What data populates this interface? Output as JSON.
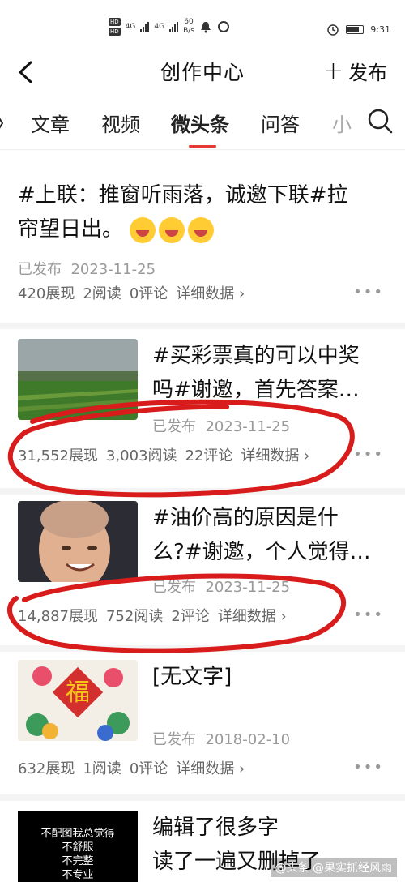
{
  "status": {
    "network_left": "4G",
    "network_right": "4G",
    "speed_value": "60",
    "speed_unit": "B/s",
    "time": "9:31"
  },
  "nav": {
    "title": "创作中心",
    "publish_label": "发布"
  },
  "tabs": [
    {
      "label": "文章"
    },
    {
      "label": "视频"
    },
    {
      "label": "微头条",
      "active": true
    },
    {
      "label": "问答"
    },
    {
      "label": "小"
    }
  ],
  "items": [
    {
      "title_line1": "#上联：推窗听雨落，诚邀下联#拉",
      "title_line2": "帘望日出。",
      "status": "已发布",
      "date": "2023-11-25",
      "impressions": "420展现",
      "reads": "2阅读",
      "comments": "0评论",
      "details": "详细数据 ›"
    },
    {
      "title_line1": "#买彩票真的可以中奖",
      "title_line2": "吗#谢邀，首先答案…",
      "status": "已发布",
      "date": "2023-11-25",
      "impressions": "31,552展现",
      "reads": "3,003阅读",
      "comments": "22评论",
      "details": "详细数据 ›"
    },
    {
      "title_line1": "#油价高的原因是什",
      "title_line2": "么?#谢邀，个人觉得…",
      "status": "已发布",
      "date": "2023-11-25",
      "impressions": "14,887展现",
      "reads": "752阅读",
      "comments": "2评论",
      "details": "详细数据 ›"
    },
    {
      "title_line1": "[无文字]",
      "status": "已发布",
      "date": "2018-02-10",
      "impressions": "632展现",
      "reads": "1阅读",
      "comments": "0评论",
      "details": "详细数据 ›"
    },
    {
      "title_line1": "编辑了很多字",
      "title_line2": "读了一遍又删掉了",
      "thumb_text": [
        "不配图我总觉得",
        "不舒服",
        "不完整",
        "不专业"
      ]
    }
  ],
  "more_label": "•••",
  "watermark": "@头条 @果实抓经风雨",
  "colors": {
    "accent": "#e53935",
    "annotation": "#d81b1b"
  }
}
